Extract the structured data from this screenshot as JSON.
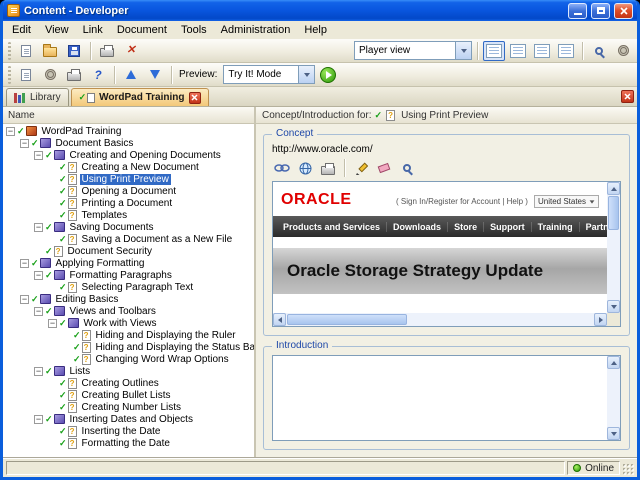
{
  "window": {
    "title": "Content - Developer"
  },
  "menubar": {
    "items": [
      "Edit",
      "View",
      "Link",
      "Document",
      "Tools",
      "Administration",
      "Help"
    ]
  },
  "toolbar_main": {
    "player_view": "Player view"
  },
  "toolbar_preview": {
    "label": "Preview:",
    "mode": "Try It! Mode"
  },
  "tabbar": {
    "tabs": [
      {
        "label": "Library",
        "active": false
      },
      {
        "label": "WordPad Training",
        "active": true
      }
    ]
  },
  "tree": {
    "header": "Name",
    "items": [
      {
        "label": "WordPad Training",
        "depth": 0,
        "type": "module",
        "children": true
      },
      {
        "label": "Document Basics",
        "depth": 1,
        "type": "section",
        "children": true
      },
      {
        "label": "Creating and Opening Documents",
        "depth": 2,
        "type": "section",
        "children": true
      },
      {
        "label": "Creating a New Document",
        "depth": 3,
        "type": "topic",
        "children": false
      },
      {
        "label": "Using Print Preview",
        "depth": 3,
        "type": "topic",
        "children": false,
        "selected": true
      },
      {
        "label": "Opening a Document",
        "depth": 3,
        "type": "topic",
        "children": false
      },
      {
        "label": "Printing a Document",
        "depth": 3,
        "type": "topic",
        "children": false
      },
      {
        "label": "Templates",
        "depth": 3,
        "type": "topic",
        "children": false
      },
      {
        "label": "Saving Documents",
        "depth": 2,
        "type": "section",
        "children": true
      },
      {
        "label": "Saving a Document as a New File",
        "depth": 3,
        "type": "topic",
        "children": false
      },
      {
        "label": "Document Security",
        "depth": 2,
        "type": "topic",
        "children": false
      },
      {
        "label": "Applying Formatting",
        "depth": 1,
        "type": "section",
        "children": true
      },
      {
        "label": "Formatting Paragraphs",
        "depth": 2,
        "type": "section",
        "children": true
      },
      {
        "label": "Selecting Paragraph Text",
        "depth": 3,
        "type": "topic",
        "children": false
      },
      {
        "label": "Editing Basics",
        "depth": 1,
        "type": "section",
        "children": true
      },
      {
        "label": "Views and Toolbars",
        "depth": 2,
        "type": "section",
        "children": true
      },
      {
        "label": "Work with Views",
        "depth": 3,
        "type": "section",
        "children": true
      },
      {
        "label": "Hiding and Displaying the Ruler",
        "depth": 4,
        "type": "topic",
        "children": false
      },
      {
        "label": "Hiding and Displaying the Status Bar",
        "depth": 4,
        "type": "topic",
        "children": false
      },
      {
        "label": "Changing Word Wrap Options",
        "depth": 4,
        "type": "topic",
        "children": false
      },
      {
        "label": "Lists",
        "depth": 2,
        "type": "section",
        "children": true
      },
      {
        "label": "Creating Outlines",
        "depth": 3,
        "type": "topic",
        "children": false
      },
      {
        "label": "Creating Bullet Lists",
        "depth": 3,
        "type": "topic",
        "children": false
      },
      {
        "label": "Creating Number Lists",
        "depth": 3,
        "type": "topic",
        "children": false
      },
      {
        "label": "Inserting Dates and Objects",
        "depth": 2,
        "type": "section",
        "children": true
      },
      {
        "label": "Inserting the Date",
        "depth": 3,
        "type": "topic",
        "children": false
      },
      {
        "label": "Formatting the Date",
        "depth": 3,
        "type": "topic",
        "children": false
      }
    ]
  },
  "right_pane": {
    "header_label": "Concept/Introduction for:",
    "header_item": "Using Print Preview",
    "concept": {
      "legend": "Concept",
      "url": "http://www.oracle.com/",
      "webpage": {
        "logo": "ORACLE",
        "account_links": "( Sign In/Register for Account | Help )",
        "region": "United States",
        "nav": [
          "Products and Services",
          "Downloads",
          "Store",
          "Support",
          "Training",
          "Partners"
        ],
        "banner": "Oracle Storage Strategy Update"
      }
    },
    "introduction": {
      "legend": "Introduction"
    }
  },
  "statusbar": {
    "status": "Online"
  }
}
